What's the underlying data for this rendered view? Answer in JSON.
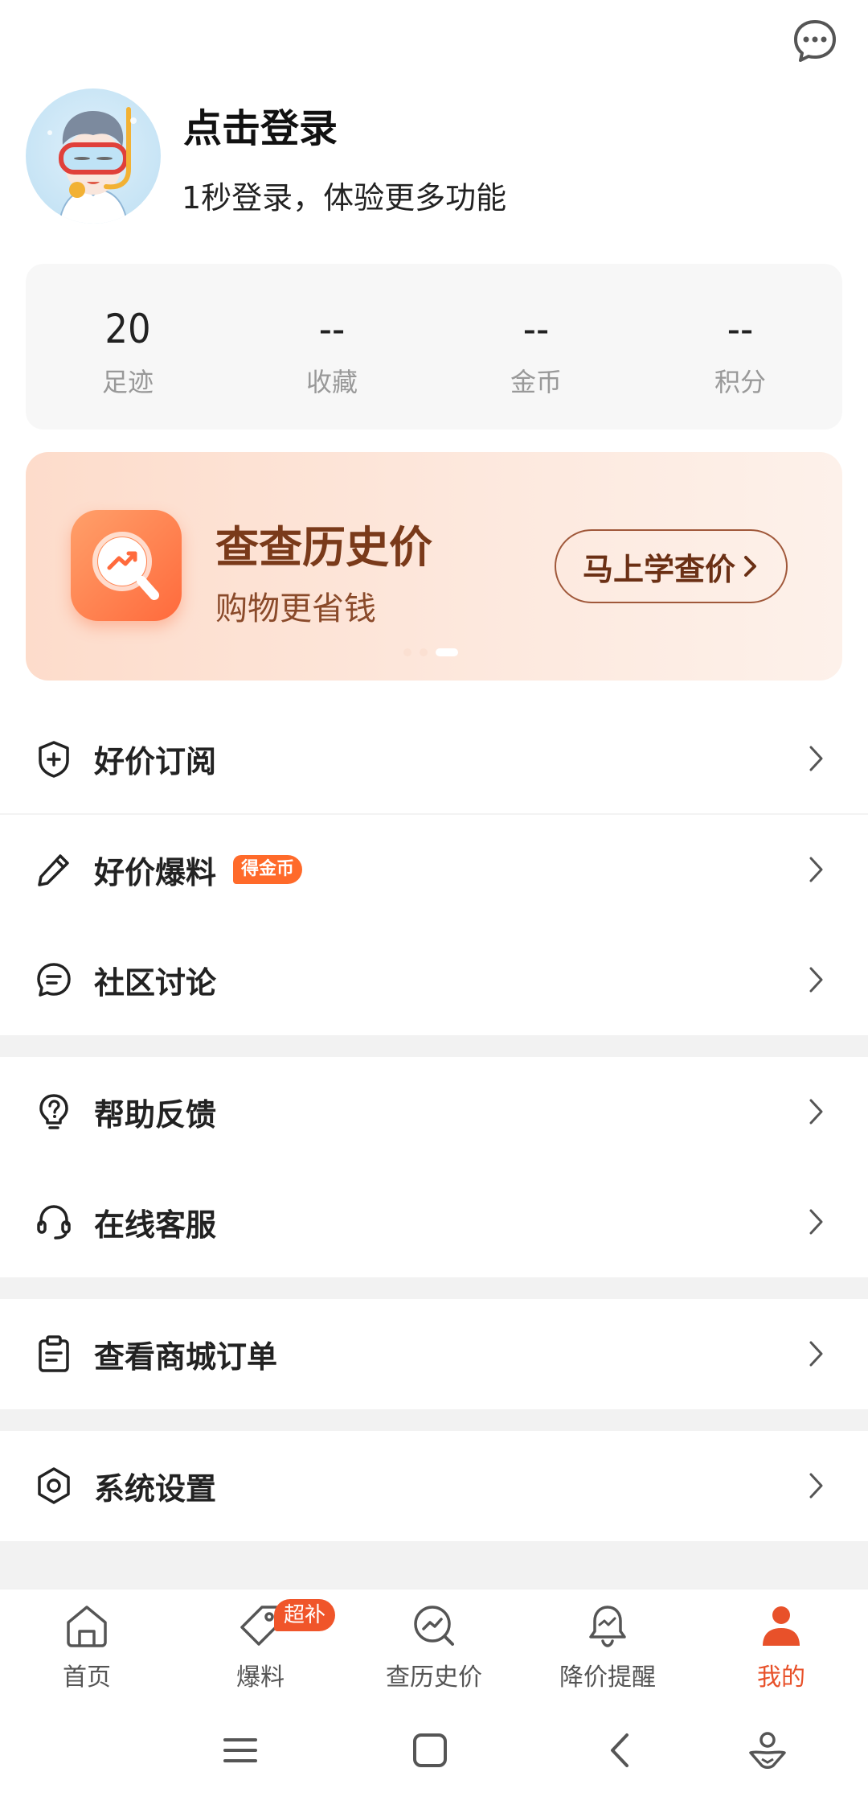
{
  "header": {
    "login_title": "点击登录",
    "login_subtitle": "1秒登录，体验更多功能"
  },
  "stats": [
    {
      "value": "20",
      "label": "足迹"
    },
    {
      "value": "--",
      "label": "收藏"
    },
    {
      "value": "--",
      "label": "金币"
    },
    {
      "value": "--",
      "label": "积分"
    }
  ],
  "banner": {
    "title": "查查历史价",
    "subtitle": "购物更省钱",
    "button_label": "马上学查价",
    "carousel_page": 3,
    "carousel_total": 3
  },
  "menu": {
    "subscribe": "好价订阅",
    "submit": "好价爆料",
    "submit_badge": "得金币",
    "community": "社区讨论",
    "help": "帮助反馈",
    "service": "在线客服",
    "orders": "查看商城订单",
    "settings": "系统设置"
  },
  "tabbar": {
    "home": "首页",
    "submit": "爆料",
    "submit_badge": "超补",
    "price_history": "查历史价",
    "price_alert": "降价提醒",
    "mine": "我的"
  },
  "colors": {
    "accent": "#e8512a",
    "badge": "#ff6a2a",
    "banner_bg": "#fde4d6"
  }
}
